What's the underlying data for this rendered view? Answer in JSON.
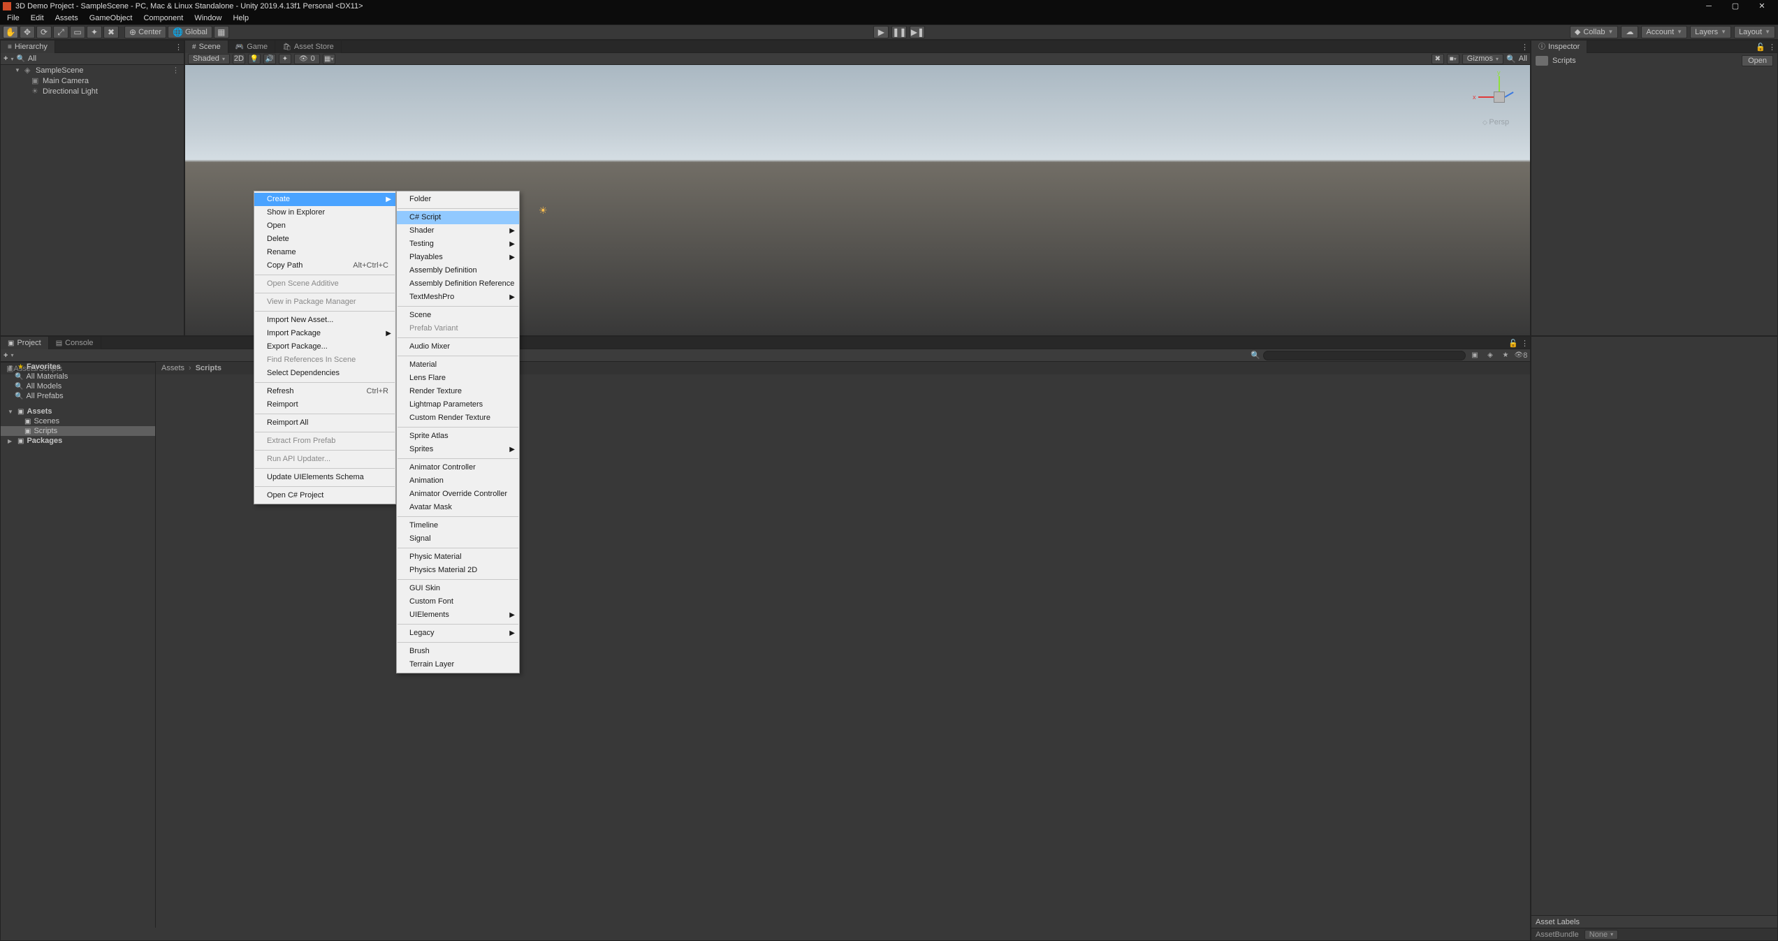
{
  "titlebar": {
    "title": "3D Demo Project - SampleScene - PC, Mac & Linux Standalone - Unity 2019.4.13f1 Personal <DX11>"
  },
  "menubar": [
    "File",
    "Edit",
    "Assets",
    "GameObject",
    "Component",
    "Window",
    "Help"
  ],
  "toolbar": {
    "center": "Center",
    "global": "Global",
    "collab": "Collab",
    "account": "Account",
    "layers": "Layers",
    "layout": "Layout"
  },
  "hierarchy": {
    "tab": "Hierarchy",
    "search_all": "All",
    "scene": "SampleScene",
    "items": [
      "Main Camera",
      "Directional Light"
    ]
  },
  "scene_panel": {
    "tabs": {
      "scene": "Scene",
      "game": "Game",
      "asset_store": "Asset Store"
    },
    "shading": "Shaded",
    "mode2d": "2D",
    "gizmos": "Gizmos",
    "search_all": "All",
    "persp": "Persp",
    "zero": "0"
  },
  "inspector": {
    "tab": "Inspector",
    "name": "Scripts",
    "open": "Open",
    "asset_labels": "Asset Labels",
    "assetbundle": "AssetBundle",
    "none": "None"
  },
  "project": {
    "tabs": {
      "project": "Project",
      "console": "Console"
    },
    "favorites": "Favorites",
    "fav_items": [
      "All Materials",
      "All Models",
      "All Prefabs"
    ],
    "assets": "Assets",
    "asset_children": [
      "Scenes",
      "Scripts"
    ],
    "packages": "Packages",
    "breadcrumb": [
      "Assets",
      "Scripts"
    ],
    "footer": "Assets/Scripts",
    "slider_badge": "8"
  },
  "ctx1": {
    "items": [
      {
        "label": "Create",
        "sub": true,
        "sel": true
      },
      {
        "label": "Show in Explorer"
      },
      {
        "label": "Open"
      },
      {
        "label": "Delete"
      },
      {
        "label": "Rename"
      },
      {
        "label": "Copy Path",
        "shortcut": "Alt+Ctrl+C"
      },
      {
        "sep": true
      },
      {
        "label": "Open Scene Additive",
        "disabled": true
      },
      {
        "sep": true
      },
      {
        "label": "View in Package Manager",
        "disabled": true
      },
      {
        "sep": true
      },
      {
        "label": "Import New Asset..."
      },
      {
        "label": "Import Package",
        "sub": true
      },
      {
        "label": "Export Package..."
      },
      {
        "label": "Find References In Scene",
        "disabled": true
      },
      {
        "label": "Select Dependencies"
      },
      {
        "sep": true
      },
      {
        "label": "Refresh",
        "shortcut": "Ctrl+R"
      },
      {
        "label": "Reimport"
      },
      {
        "sep": true
      },
      {
        "label": "Reimport All"
      },
      {
        "sep": true
      },
      {
        "label": "Extract From Prefab",
        "disabled": true
      },
      {
        "sep": true
      },
      {
        "label": "Run API Updater...",
        "disabled": true
      },
      {
        "sep": true
      },
      {
        "label": "Update UIElements Schema"
      },
      {
        "sep": true
      },
      {
        "label": "Open C# Project"
      }
    ]
  },
  "ctx2": {
    "items": [
      {
        "label": "Folder"
      },
      {
        "sep": true
      },
      {
        "label": "C# Script",
        "sel": true
      },
      {
        "label": "Shader",
        "sub": true
      },
      {
        "label": "Testing",
        "sub": true
      },
      {
        "label": "Playables",
        "sub": true
      },
      {
        "label": "Assembly Definition"
      },
      {
        "label": "Assembly Definition Reference"
      },
      {
        "label": "TextMeshPro",
        "sub": true
      },
      {
        "sep": true
      },
      {
        "label": "Scene"
      },
      {
        "label": "Prefab Variant",
        "disabled": true
      },
      {
        "sep": true
      },
      {
        "label": "Audio Mixer"
      },
      {
        "sep": true
      },
      {
        "label": "Material"
      },
      {
        "label": "Lens Flare"
      },
      {
        "label": "Render Texture"
      },
      {
        "label": "Lightmap Parameters"
      },
      {
        "label": "Custom Render Texture"
      },
      {
        "sep": true
      },
      {
        "label": "Sprite Atlas"
      },
      {
        "label": "Sprites",
        "sub": true
      },
      {
        "sep": true
      },
      {
        "label": "Animator Controller"
      },
      {
        "label": "Animation"
      },
      {
        "label": "Animator Override Controller"
      },
      {
        "label": "Avatar Mask"
      },
      {
        "sep": true
      },
      {
        "label": "Timeline"
      },
      {
        "label": "Signal"
      },
      {
        "sep": true
      },
      {
        "label": "Physic Material"
      },
      {
        "label": "Physics Material 2D"
      },
      {
        "sep": true
      },
      {
        "label": "GUI Skin"
      },
      {
        "label": "Custom Font"
      },
      {
        "label": "UIElements",
        "sub": true
      },
      {
        "sep": true
      },
      {
        "label": "Legacy",
        "sub": true
      },
      {
        "sep": true
      },
      {
        "label": "Brush"
      },
      {
        "label": "Terrain Layer"
      }
    ]
  }
}
